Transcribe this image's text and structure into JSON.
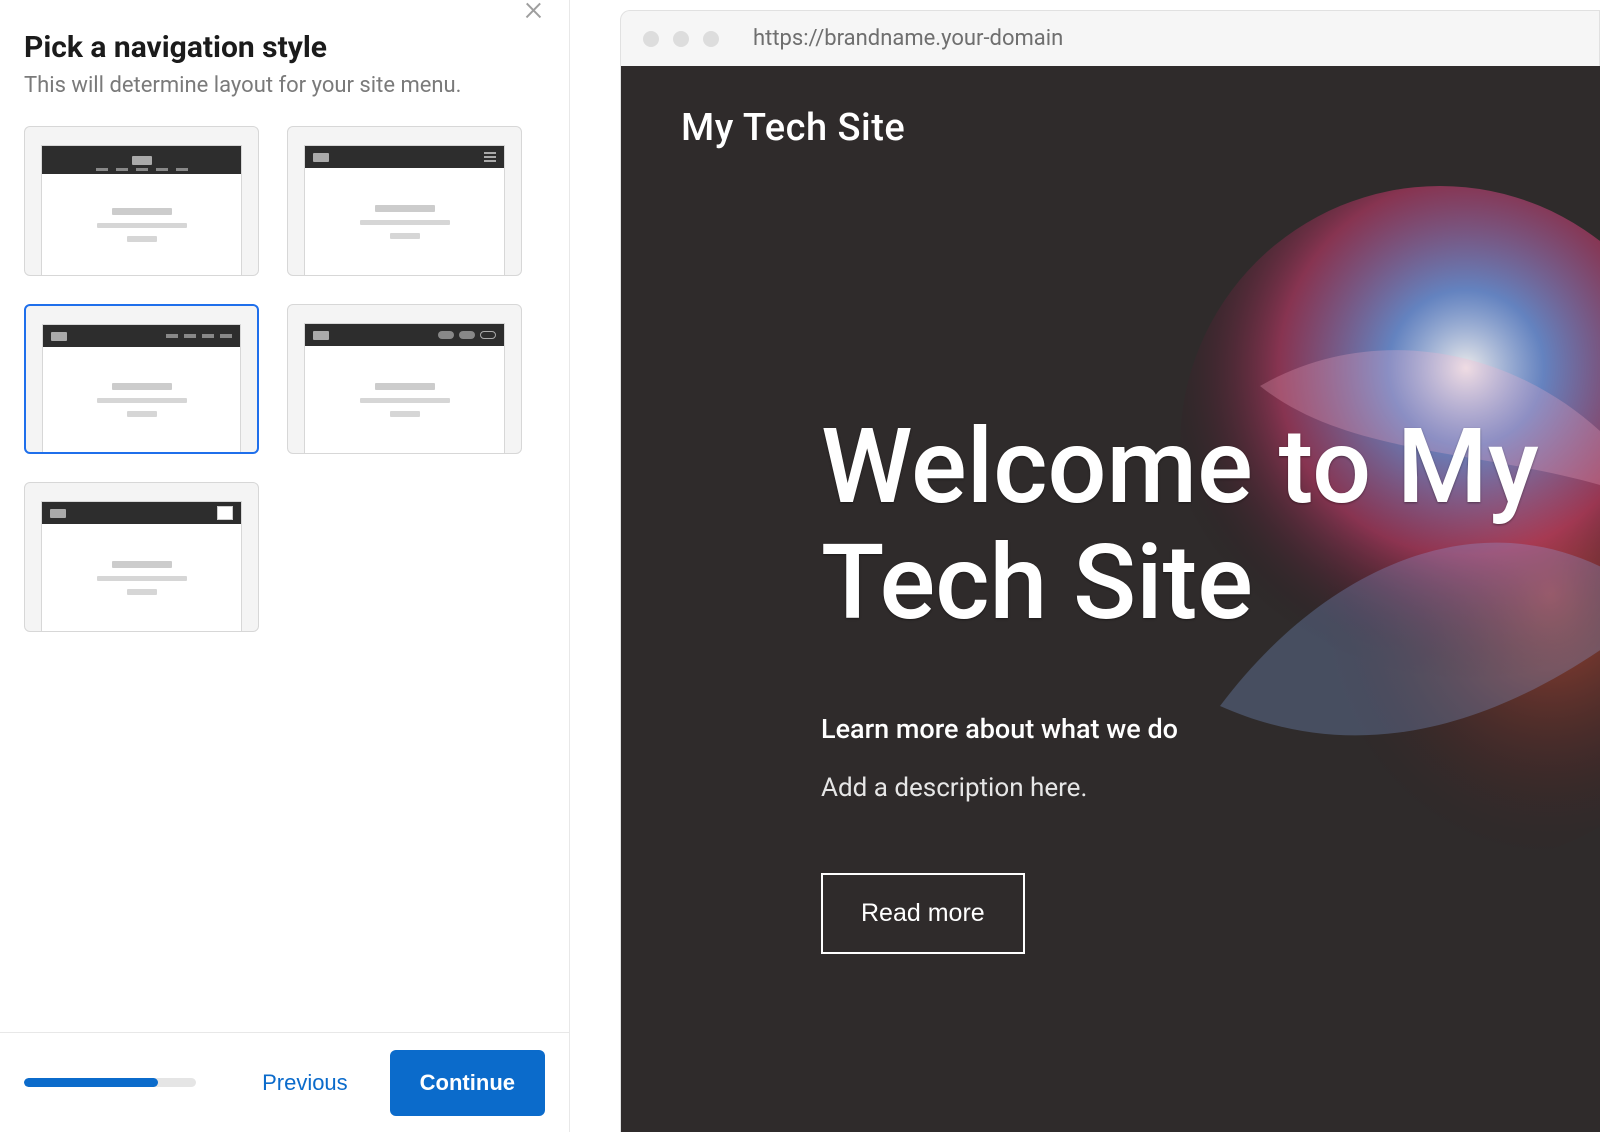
{
  "panel": {
    "title": "Pick a navigation style",
    "subtitle": "This will determine layout for your site menu.",
    "close_icon": "×"
  },
  "nav_styles": {
    "options": [
      {
        "id": "centered-logo-links-below",
        "selected": false
      },
      {
        "id": "left-logo-hamburger-right",
        "selected": false
      },
      {
        "id": "left-logo-links-right",
        "selected": true
      },
      {
        "id": "left-logo-pill-buttons-right",
        "selected": false
      },
      {
        "id": "left-logo-light-hamburger-right",
        "selected": false
      }
    ]
  },
  "footer": {
    "previous_label": "Previous",
    "continue_label": "Continue",
    "progress_percent": 78
  },
  "preview": {
    "url": "https://brandname.your-domain",
    "site_title": "My Tech Site",
    "hero_heading": "Welcome to My Tech Site",
    "hero_sub": "Learn more about what we do",
    "hero_desc": "Add a description here.",
    "hero_button": "Read more"
  }
}
